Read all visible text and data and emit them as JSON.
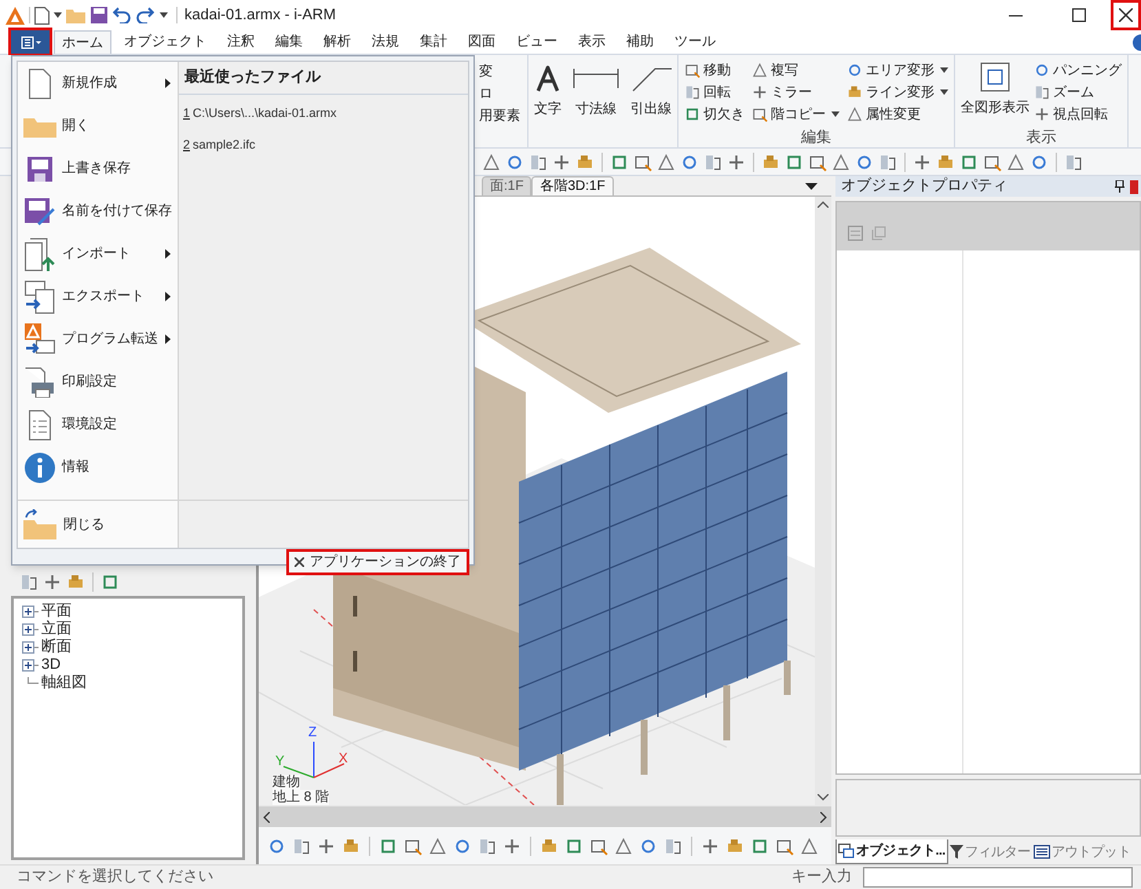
{
  "window": {
    "title": "kadai-01.armx - i-ARM",
    "close_highlighted": true
  },
  "app_button": {
    "highlighted": true
  },
  "ribbon_tabs": [
    {
      "label": "ホーム",
      "selected": true
    },
    {
      "label": "オブジェクト",
      "selected": false
    },
    {
      "label": "注釈",
      "selected": false
    },
    {
      "label": "編集",
      "selected": false
    },
    {
      "label": "解析",
      "selected": false
    },
    {
      "label": "法規",
      "selected": false
    },
    {
      "label": "集計",
      "selected": false
    },
    {
      "label": "図面",
      "selected": false
    },
    {
      "label": "ビュー",
      "selected": false
    },
    {
      "label": "表示",
      "selected": false
    },
    {
      "label": "補助",
      "selected": false
    },
    {
      "label": "ツール",
      "selected": false
    }
  ],
  "ribbon": {
    "partial_labels": [
      "変",
      "ロ",
      "用要素"
    ],
    "annotation_buttons": [
      "文字",
      "寸法線",
      "引出線"
    ],
    "edit_group": {
      "label": "編集",
      "buttons": [
        {
          "label": "移動",
          "dropdown": false
        },
        {
          "label": "複写",
          "dropdown": false
        },
        {
          "label": "エリア変形",
          "dropdown": true
        },
        {
          "label": "回転",
          "dropdown": false
        },
        {
          "label": "ミラー",
          "dropdown": false
        },
        {
          "label": "ライン変形",
          "dropdown": true
        },
        {
          "label": "切欠き",
          "dropdown": false
        },
        {
          "label": "階コピー",
          "dropdown": true
        },
        {
          "label": "属性変更",
          "dropdown": false
        }
      ]
    },
    "view_group": {
      "label": "表示",
      "large_button": "全図形表示",
      "buttons": [
        "パンニング",
        "ズーム",
        "視点回転"
      ]
    }
  },
  "app_menu": {
    "items": [
      {
        "label": "新規作成",
        "submenu": true
      },
      {
        "label": "開く",
        "submenu": false
      },
      {
        "label": "上書き保存",
        "submenu": false
      },
      {
        "label": "名前を付けて保存",
        "submenu": false
      },
      {
        "label": "インポート",
        "submenu": true
      },
      {
        "label": "エクスポート",
        "submenu": true
      },
      {
        "label": "プログラム転送",
        "submenu": true
      },
      {
        "label": "印刷設定",
        "submenu": false
      },
      {
        "label": "環境設定",
        "submenu": false
      },
      {
        "label": "情報",
        "submenu": false
      }
    ],
    "close_item": "閉じる",
    "recent_title": "最近使ったファイル",
    "recent_files": [
      {
        "key": "1",
        "path": "C:\\Users\\...\\kadai-01.armx"
      },
      {
        "key": "2",
        "path": "sample2.ifc"
      }
    ],
    "exit": {
      "label": "アプリケーションの終了",
      "highlighted": true
    }
  },
  "view_tree": [
    {
      "label": "平面",
      "kind": "node",
      "expanded": false
    },
    {
      "label": "立面",
      "kind": "node",
      "expanded": false
    },
    {
      "label": "断面",
      "kind": "node",
      "expanded": false
    },
    {
      "label": "3D",
      "kind": "node",
      "expanded": false
    },
    {
      "label": "軸組図",
      "kind": "leaf"
    }
  ],
  "viewport": {
    "tabs": [
      {
        "label": "面:1F",
        "selected": false
      },
      {
        "label": "各階3D:1F",
        "selected": true
      }
    ],
    "axes": {
      "x": "X",
      "y": "Y",
      "z": "Z"
    },
    "info": [
      "建物",
      "地上 8 階"
    ]
  },
  "properties_panel": {
    "title": "オブジェクトプロパティ",
    "tabs": [
      {
        "label": "オブジェクト...",
        "selected": true
      },
      {
        "label": "フィルター",
        "selected": false
      },
      {
        "label": "アウトプット",
        "selected": false
      }
    ]
  },
  "status_bar": {
    "message": "コマンドを選択してください",
    "key_input_label": "キー入力"
  }
}
